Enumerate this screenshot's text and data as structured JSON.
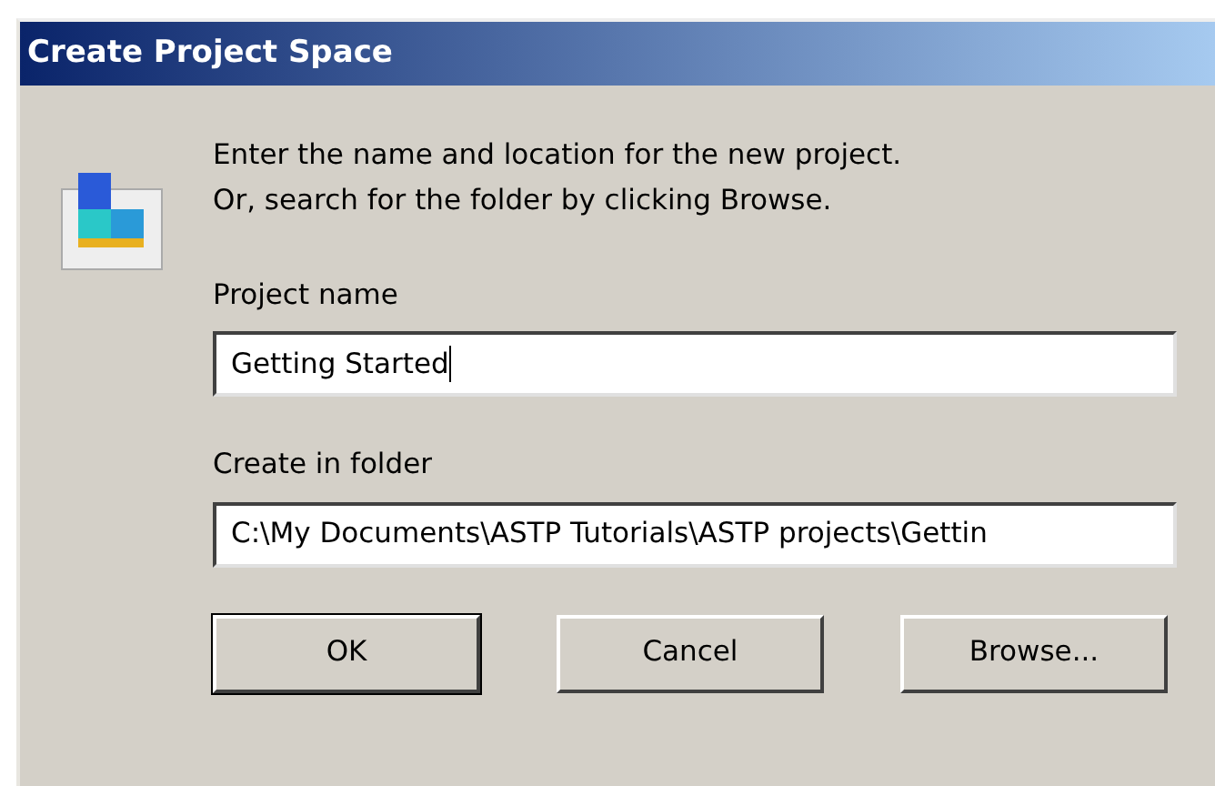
{
  "window": {
    "title": "Create Project Space"
  },
  "instructions": [
    "Enter the name and location for the new project.",
    "Or, search for the folder by clicking Browse."
  ],
  "fields": [
    {
      "label": "Project name",
      "value": "Getting Started",
      "focused": true
    },
    {
      "label": "Create in folder",
      "value": "C:\\My Documents\\ASTP Tutorials\\ASTP projects\\Gettin",
      "focused": false
    }
  ],
  "buttons": [
    {
      "label": "OK",
      "default": true
    },
    {
      "label": "Cancel",
      "default": false
    },
    {
      "label": "Browse...",
      "default": false
    }
  ]
}
